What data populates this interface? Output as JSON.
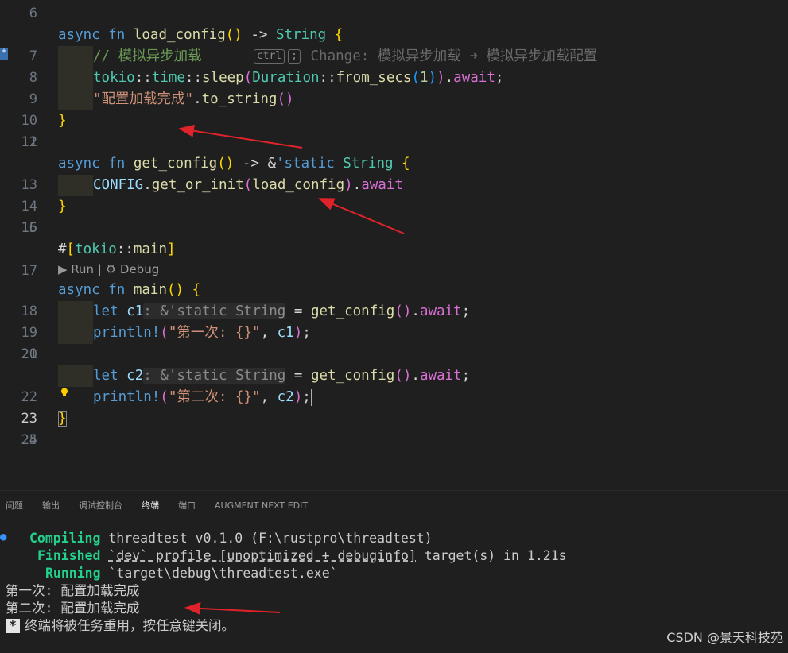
{
  "editor": {
    "line_numbers": [
      "6",
      "7",
      "8",
      "9",
      "10",
      "11",
      "12",
      "13",
      "14",
      "15",
      "16",
      "17",
      "18",
      "19",
      "20",
      "21",
      "22",
      "23",
      "24",
      "25"
    ],
    "l7": {
      "kw1": "async",
      "kw2": "fn",
      "fn": "load_config",
      "p": "()",
      "arrow": " -> ",
      "ty": "String",
      "brace": " {"
    },
    "l8": {
      "comment": "// 模拟异步加载",
      "kbd1": "ctrl",
      "kbd2": ";",
      "ghost": "Change: 模拟异步加载 ➜ 模拟异步加载配置"
    },
    "l9": {
      "mod": "tokio",
      "sep1": "::",
      "mod2": "time",
      "sep2": "::",
      "fn": "sleep",
      "po": "(",
      "ty": "Duration",
      "sep3": "::",
      "fn2": "from_secs",
      "pi": "(",
      "num": "1",
      "pic": ")",
      "pc": ")",
      "dot": ".",
      "kw": "await",
      "semi": ";"
    },
    "l10": {
      "str": "\"配置加载完成\"",
      "dot": ".",
      "fn": "to_string",
      "p": "()"
    },
    "l11": {
      "brace": "}"
    },
    "l13": {
      "kw1": "async",
      "kw2": "fn",
      "fn": "get_config",
      "p": "()",
      "arrow": " -> &",
      "lt": "'static",
      "ty": "String",
      "brace": " {"
    },
    "l14": {
      "var": "CONFIG",
      "dot": ".",
      "fn": "get_or_init",
      "po": "(",
      "arg": "load_config",
      "pc": ")",
      "dot2": ".",
      "kw": "await"
    },
    "l15": {
      "brace": "}"
    },
    "l17": {
      "hash": "#",
      "bo": "[",
      "mod": "tokio",
      "sep": "::",
      "attr": "main",
      "bc": "]"
    },
    "codelens": {
      "run": "▶ Run",
      "sep": " | ",
      "debug": "⚙ Debug"
    },
    "l18": {
      "kw1": "async",
      "kw2": "fn",
      "fn": "main",
      "p": "()",
      "brace": " {"
    },
    "l19": {
      "kw": "let",
      "var": "c1",
      "hint": ": &'static String",
      "eq": " = ",
      "fn": "get_config",
      "p": "()",
      "dot": ".",
      "aw": "await",
      "semi": ";"
    },
    "l20": {
      "mac": "println!",
      "po": "(",
      "str": "\"第一次: {}\"",
      "comma": ", ",
      "var": "c1",
      "pc": ")",
      "semi": ";"
    },
    "l22": {
      "kw": "let",
      "var": "c2",
      "hint": ": &'static String",
      "eq": " = ",
      "fn": "get_config",
      "p": "()",
      "dot": ".",
      "aw": "await",
      "semi": ";"
    },
    "l23": {
      "mac": "println!",
      "po": "(",
      "str": "\"第二次: {}\"",
      "comma": ", ",
      "var": "c2",
      "pc": ")",
      "semi": ";"
    },
    "l24": {
      "brace": "}"
    },
    "current_line": "23",
    "colors": {
      "keyword": "#569cd6",
      "function": "#dcdcaa",
      "type": "#4ec9b0",
      "string": "#ce9178",
      "arrow": "#e0232a"
    }
  },
  "panel": {
    "tabs": [
      "问题",
      "输出",
      "调试控制台",
      "终端",
      "端口",
      "AUGMENT NEXT EDIT"
    ],
    "active_tab": "终端"
  },
  "terminal": {
    "compiling_label": "Compiling",
    "compiling_text": " threadtest v0.1.0 (F:\\rustpro\\threadtest)",
    "finished_label": "Finished",
    "finished_a": " ",
    "finished_dev": "`dev` profile [unoptimized + debuginfo]",
    "finished_b": " target(s) in 1.21s",
    "running_label": "Running",
    "running_text": " `target\\debug\\threadtest.exe`",
    "out1": "第一次: 配置加载完成",
    "out2": "第二次: 配置加载完成",
    "star": "*",
    "reuse_msg": "终端将被任务重用，按任意键关闭。"
  },
  "watermark": "CSDN @景天科技苑"
}
